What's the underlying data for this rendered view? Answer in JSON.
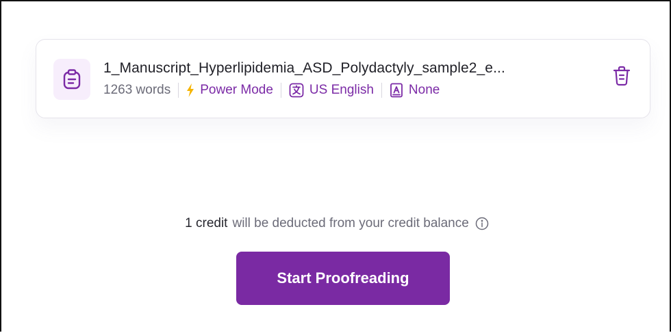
{
  "file": {
    "name": "1_Manuscript_Hyperlipidemia_ASD_Polydactyly_sample2_e...",
    "icon": "clipboard-icon",
    "word_count": "1263 words",
    "mode": {
      "label": "Power Mode",
      "icon": "lightning-icon",
      "color": "#f5b400"
    },
    "language": {
      "label": "US English",
      "icon": "language-icon"
    },
    "style": {
      "label": "None",
      "icon": "style-guide-icon"
    },
    "delete_icon": "trash-icon"
  },
  "credit": {
    "amount": "1 credit",
    "message": "will be deducted from your credit balance",
    "info_icon": "info-icon"
  },
  "actions": {
    "start_label": "Start Proofreading"
  },
  "colors": {
    "accent": "#7a2aa3",
    "accent_text": "#7b2aa6",
    "icon_bg": "#f7eefc",
    "muted_text": "#6b6b78"
  }
}
